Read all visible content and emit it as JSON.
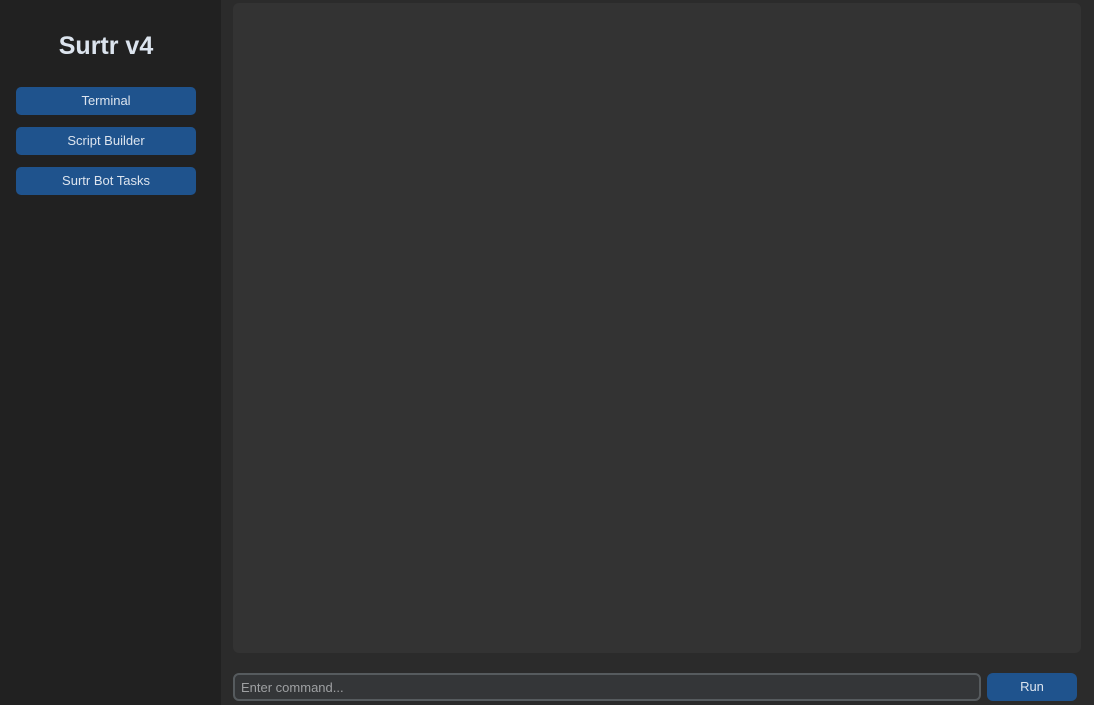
{
  "sidebar": {
    "title": "Surtr v4",
    "items": [
      {
        "label": "Terminal"
      },
      {
        "label": "Script Builder"
      },
      {
        "label": "Surtr Bot Tasks"
      }
    ]
  },
  "main": {
    "output": "",
    "command": {
      "value": "",
      "placeholder": "Enter command..."
    },
    "run_label": "Run"
  },
  "colors": {
    "sidebar_bg": "#212121",
    "main_bg": "#2b2b2b",
    "panel_bg": "#333333",
    "accent": "#1f538d",
    "text": "#dce4ee"
  }
}
